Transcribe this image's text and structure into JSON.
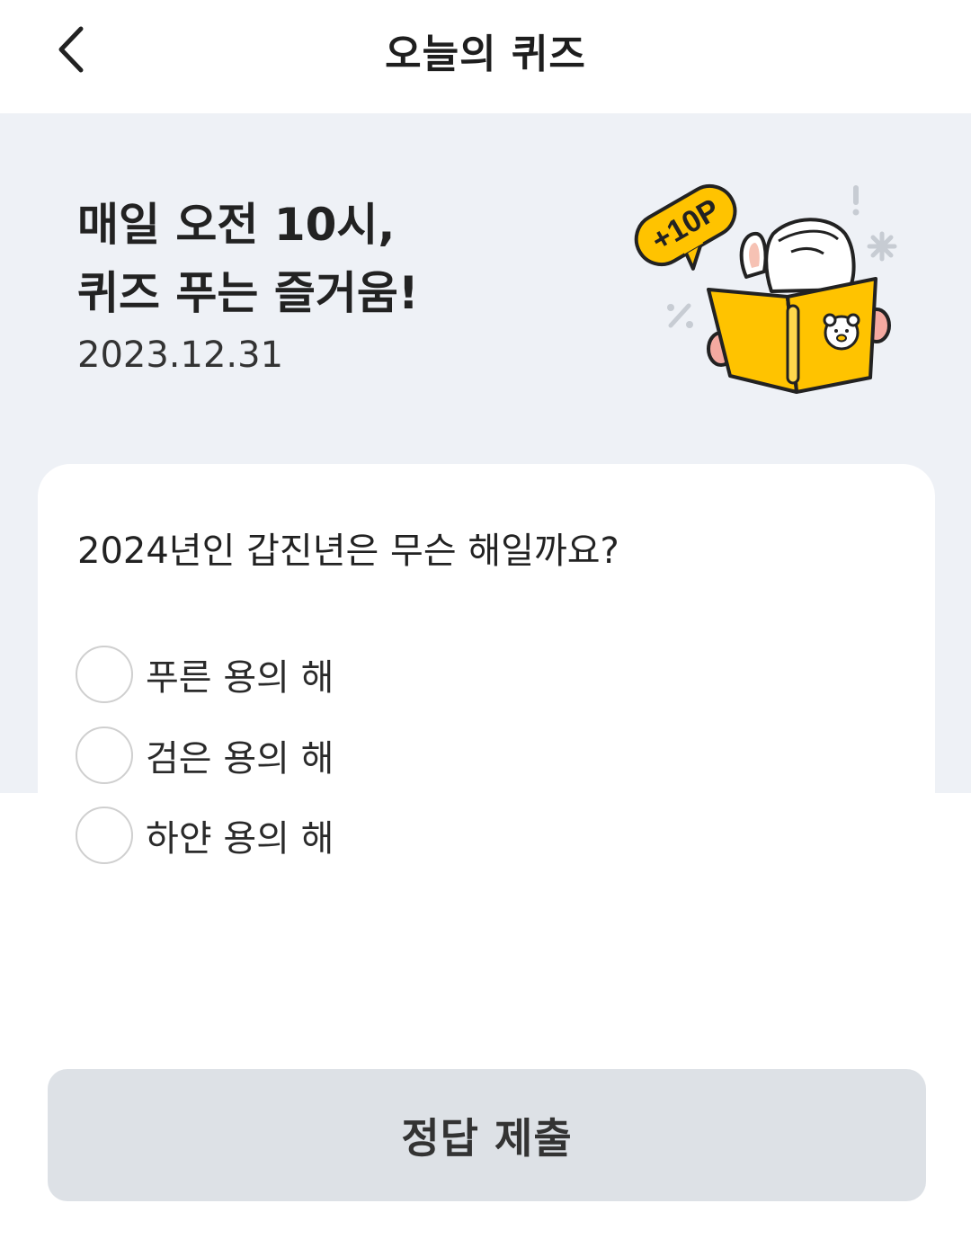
{
  "header": {
    "title": "오늘의 퀴즈",
    "back_icon": "chevron-left-icon"
  },
  "hero": {
    "headline_line1": "매일 오전 10시,",
    "headline_line2": "퀴즈 푸는 즐거움!",
    "date": "2023.12.31",
    "badge_text": "+10P",
    "illustration": "rabbit-reading-book-illustration"
  },
  "quiz": {
    "question": "2024년인 갑진년은 무슨 해일까요?",
    "options": [
      {
        "label": "푸른 용의 해",
        "selected": false
      },
      {
        "label": "검은 용의 해",
        "selected": false
      },
      {
        "label": "하얀 용의 해",
        "selected": false
      }
    ]
  },
  "footer": {
    "submit_label": "정답 제출"
  },
  "colors": {
    "hero_background": "#eef1f6",
    "badge_yellow": "#ffc300",
    "button_disabled": "#dde1e6",
    "radio_border": "#cfcfcf"
  }
}
